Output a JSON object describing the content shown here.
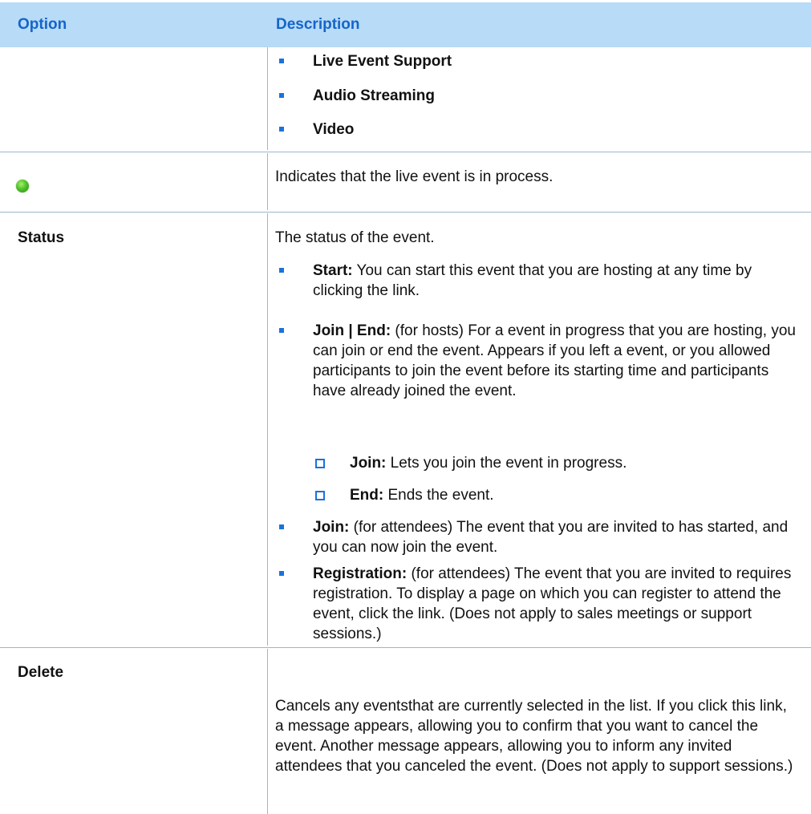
{
  "header": {
    "option": "Option",
    "description": "Description"
  },
  "row1": {
    "bullets": [
      "Live Event Support",
      "Audio Streaming",
      "Video"
    ]
  },
  "row2": {
    "icon": "green-status-icon",
    "description": "Indicates that the live event is in process."
  },
  "row3": {
    "option": "Status",
    "intro": "The status of the event.",
    "items": [
      {
        "term": "Start:",
        "text": " You can start this event that you are hosting at any time by clicking the link."
      },
      {
        "term": "Join | End:",
        "text": " (for hosts) For a event in progress that you are hosting, you can join or end the event. Appears if you left a event, or you allowed participants to join the event before its starting time and participants have already joined the event."
      },
      {
        "term": "Join:",
        "text": " (for attendees) The event that you are invited to has started, and you can now join the event."
      },
      {
        "term": "Registration:",
        "text": " (for attendees) The event that you are invited to requires registration. To display a page on which you can register to attend the event, click the link. (Does not apply to sales meetings or support sessions.)"
      }
    ],
    "subitems": [
      {
        "term": "Join:",
        "text": " Lets you join the event in progress."
      },
      {
        "term": "End:",
        "text": " Ends the event."
      }
    ]
  },
  "row4": {
    "option": "Delete",
    "description": "Cancels any eventsthat are currently selected in the list. If you click this link, a message appears, allowing you to confirm that you want to cancel the event. Another message appears, allowing you to inform any invited attendees that you canceled the event. (Does not apply to support sessions.)"
  },
  "colors": {
    "header_bg": "#b8dbf7",
    "header_text": "#1565c9",
    "bullet": "#1a73d9",
    "rule": "#9bb7c9"
  }
}
